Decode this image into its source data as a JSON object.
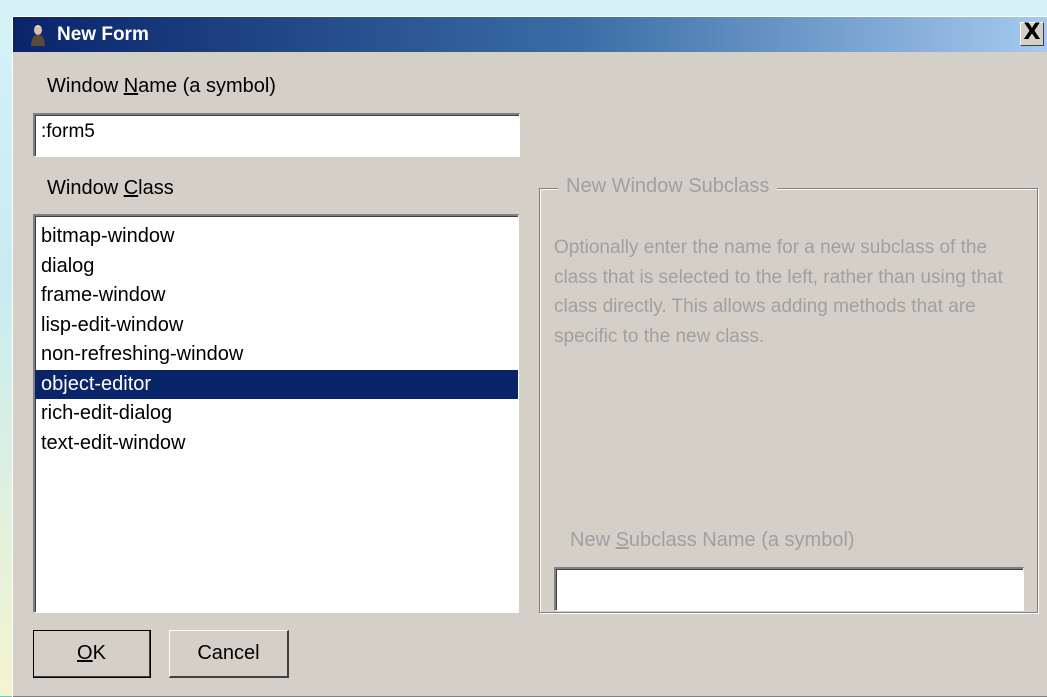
{
  "window": {
    "title": "New Form",
    "close_label": "X"
  },
  "window_name": {
    "label_pre": "Window ",
    "label_accel": "N",
    "label_post": "ame (a symbol)",
    "value": ":form5"
  },
  "window_class": {
    "label_pre": "Window ",
    "label_accel": "C",
    "label_post": "lass",
    "items": [
      "bitmap-window",
      "dialog",
      "frame-window",
      "lisp-edit-window",
      "non-refreshing-window",
      "object-editor",
      "rich-edit-dialog",
      "text-edit-window"
    ],
    "selected_index": 5
  },
  "subclass_group": {
    "legend": "New Window Subclass",
    "description": "Optionally enter the name for a new subclass of the class that is selected to the left, rather than using that class directly. This allows adding methods that are specific to the new class.",
    "name_label_pre": "New ",
    "name_label_accel": "S",
    "name_label_post": "ubclass Name (a symbol)",
    "name_value": ""
  },
  "buttons": {
    "ok_accel": "O",
    "ok_rest": "K",
    "cancel": "Cancel"
  },
  "colors": {
    "selection": "#0a246a",
    "dialog_bg": "#d4d0c8",
    "disabled_text": "#a0a0a0"
  }
}
